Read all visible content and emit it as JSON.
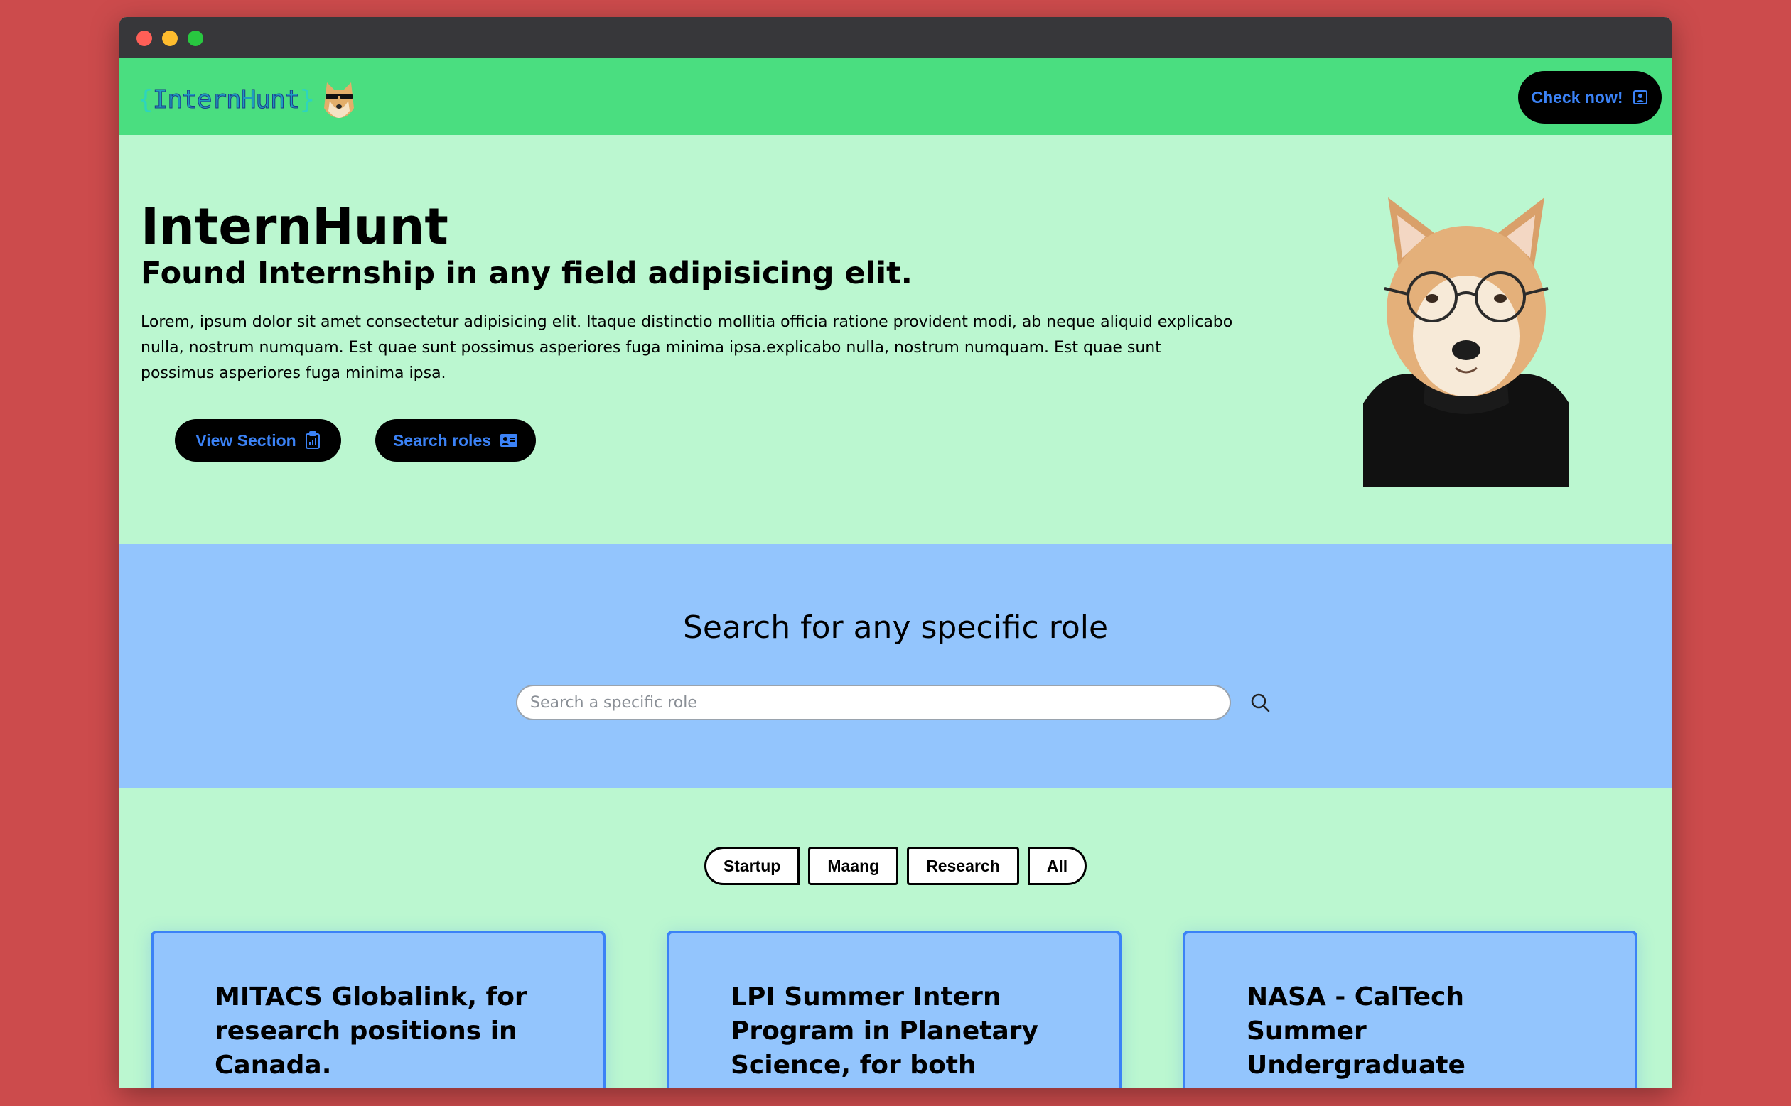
{
  "navbar": {
    "logo_brace_open": "{",
    "logo_text": "InternHunt",
    "logo_brace_close": "}",
    "cta_label": "Check now!",
    "cta_icon": "person-badge-icon"
  },
  "hero": {
    "title": "InternHunt",
    "subtitle": "Found Internship in any field adipisicing elit.",
    "paragraph": "Lorem, ipsum dolor sit amet consectetur adipisicing elit. Itaque distinctio mollitia officia ratione provident modi, ab neque aliquid explicabo nulla, nostrum numquam. Est quae sunt possimus asperiores fuga minima ipsa.explicabo nulla, nostrum numquam. Est quae sunt possimus asperiores fuga minima ipsa.",
    "buttons": [
      {
        "label": "View Section",
        "icon": "clipboard-data-icon"
      },
      {
        "label": "Search roles",
        "icon": "person-vcard-icon"
      }
    ]
  },
  "search": {
    "title": "Search for any specific role",
    "placeholder": "Search a specific role",
    "value": "",
    "icon": "search-icon"
  },
  "filters": [
    "Startup",
    "Maang",
    "Research",
    "All"
  ],
  "cards": [
    {
      "title": "MITACS Globalink, for research positions in Canada."
    },
    {
      "title": "LPI Summer Intern Program in Planetary Science, for both national and"
    },
    {
      "title": "NASA - CalTech Summer Undergraduate Research Fellowship (SURF), for"
    }
  ],
  "colors": {
    "page_bg": "#cc4b4c",
    "navbar": "#4ade80",
    "hero_bg": "#bbf7d0",
    "search_bg": "#93c5fd",
    "accent_blue": "#3b82f6",
    "button_bg": "#000000"
  }
}
